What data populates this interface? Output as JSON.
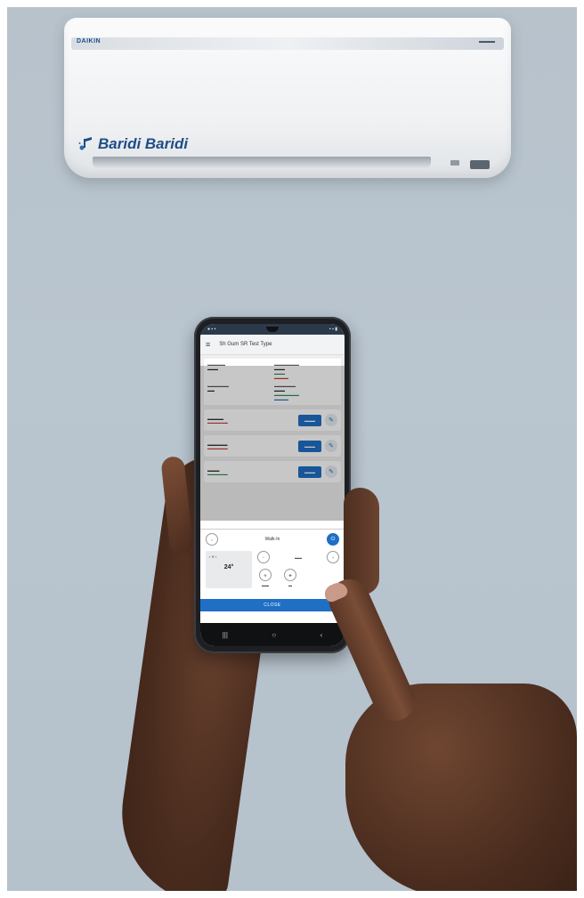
{
  "scene": {
    "background_color": "#b8c4ce",
    "air_conditioner": {
      "brand_small": "DAIKIN",
      "product_logo_text": "Baridi Baridi",
      "accent_color": "#1f4d86"
    },
    "phone": {
      "app_bar_title": "Sh Gum SR Test Type",
      "bottom_sheet": {
        "title": "Walk-In",
        "temperature": "24°"
      },
      "close_button": "CLOSE",
      "accent_color": "#1f6fc4",
      "nav_icons": [
        "nav-recent-icon",
        "nav-home-icon",
        "nav-back-icon"
      ]
    }
  }
}
